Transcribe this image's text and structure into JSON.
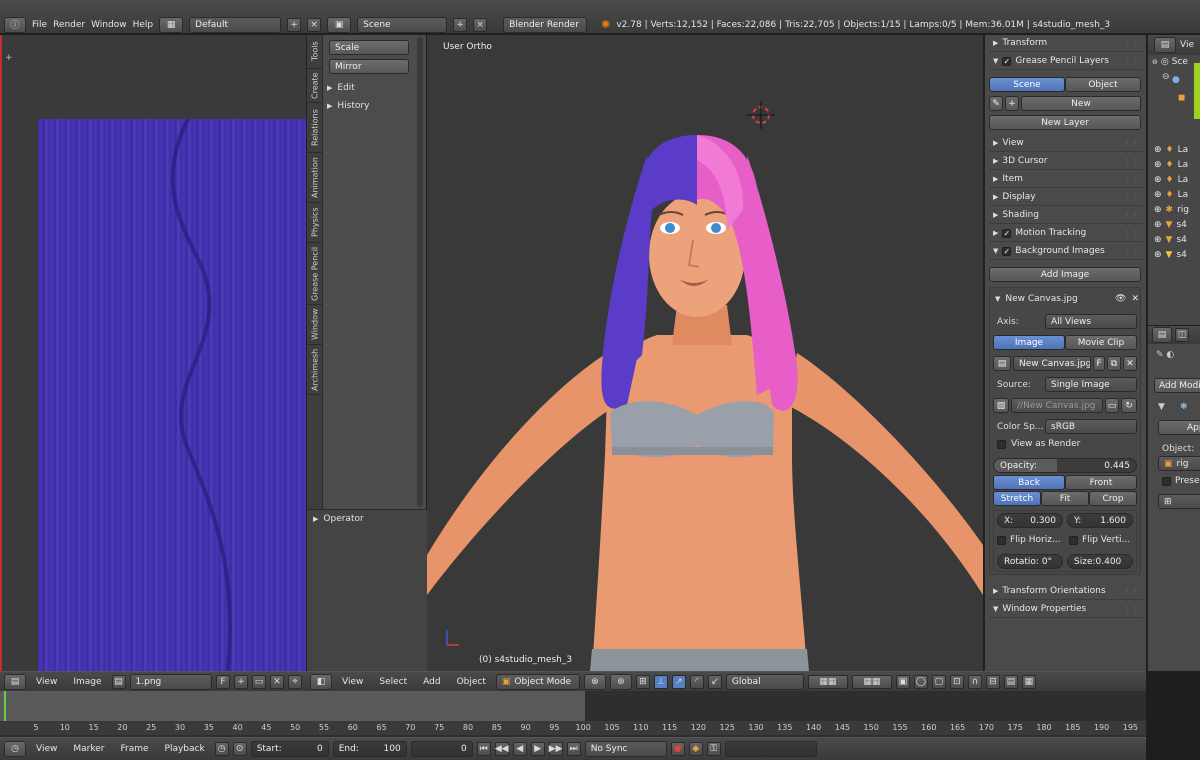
{
  "topbar": {
    "menus": [
      "File",
      "Render",
      "Window",
      "Help"
    ],
    "layout": "Default",
    "scene": "Scene",
    "engine": "Blender Render",
    "stats": "v2.78 | Verts:12,152 | Faces:22,086 | Tris:22,705 | Objects:1/15 | Lamps:0/5 | Mem:36.01M | s4studio_mesh_3"
  },
  "tools": {
    "tabs": [
      "Tools",
      "Create",
      "Relations",
      "Animation",
      "Physics",
      "Grease Pencil",
      "Window",
      "Archimesh"
    ],
    "buttons": [
      "Scale",
      "Mirror"
    ],
    "panels": [
      "Edit",
      "History"
    ],
    "operator": "Operator"
  },
  "viewport": {
    "view_label": "User Ortho",
    "object_label": "(0) s4studio_mesh_3"
  },
  "props": {
    "transform": "Transform",
    "gp_layers": "Grease Pencil Layers",
    "scene_btn": "Scene",
    "object_btn": "Object",
    "new_btn": "New",
    "new_layer": "New Layer",
    "view": "View",
    "cursor": "3D Cursor",
    "item": "Item",
    "display": "Display",
    "shading": "Shading",
    "motion": "Motion Tracking",
    "bg_images": "Background Images",
    "add_image": "Add Image",
    "canvas_name": "New Canvas.jpg",
    "axis_label": "Axis:",
    "axis_value": "All Views",
    "image_tab": "Image",
    "movie_tab": "Movie Clip",
    "img_field": "New Canvas.jpg",
    "f_label": "F",
    "source_label": "Source:",
    "source_value": "Single Image",
    "path": "//New Canvas.jpg",
    "color_label": "Color Sp...",
    "color_value": "sRGB",
    "view_render": "View as Render",
    "opacity_label": "Opacity:",
    "opacity_value": "0.445",
    "back": "Back",
    "front": "Front",
    "stretch": "Stretch",
    "fit": "Fit",
    "crop": "Crop",
    "x_label": "X:",
    "x_value": "0.300",
    "y_label": "Y:",
    "y_value": "1.600",
    "flip_h": "Flip Horiz...",
    "flip_v": "Flip Verti...",
    "rot": "Rotatio: 0°",
    "size": "Size:0.400",
    "transform_orient": "Transform Orientations",
    "window_props": "Window Properties"
  },
  "outliner": {
    "view": "Vie",
    "scene": "Sce",
    "items": [
      "La",
      "La",
      "La",
      "La",
      "rig",
      "s4",
      "s4",
      "s4"
    ]
  },
  "modifier": {
    "add": "Add Modifi",
    "apply": "App",
    "object_label": "Object:",
    "rig": "rig",
    "preserve": "Preser"
  },
  "uv_header": {
    "view": "View",
    "image": "Image",
    "file": "1.png",
    "f": "F"
  },
  "view3d_header": {
    "view": "View",
    "select": "Select",
    "add": "Add",
    "object": "Object",
    "mode": "Object Mode",
    "orientation": "Global"
  },
  "timeline": {
    "ticks": [
      "5",
      "10",
      "15",
      "20",
      "25",
      "30",
      "35",
      "40",
      "45",
      "50",
      "55",
      "60",
      "65",
      "70",
      "75",
      "80",
      "85",
      "90",
      "95",
      "100",
      "105",
      "110",
      "115",
      "120",
      "125",
      "130",
      "135",
      "140",
      "145",
      "150",
      "155",
      "160",
      "165",
      "170",
      "175",
      "180",
      "185",
      "190",
      "195"
    ]
  },
  "bottombar": {
    "view": "View",
    "marker": "Marker",
    "frame": "Frame",
    "playback": "Playback",
    "start_label": "Start:",
    "start_value": "0",
    "end_label": "End:",
    "end_value": "100",
    "current": "0",
    "sync": "No Sync"
  },
  "colors": {
    "accent": "#5680c2",
    "hair_left": "#5a3cc8",
    "hair_right": "#e85ec8",
    "skin": "#e8946a"
  }
}
